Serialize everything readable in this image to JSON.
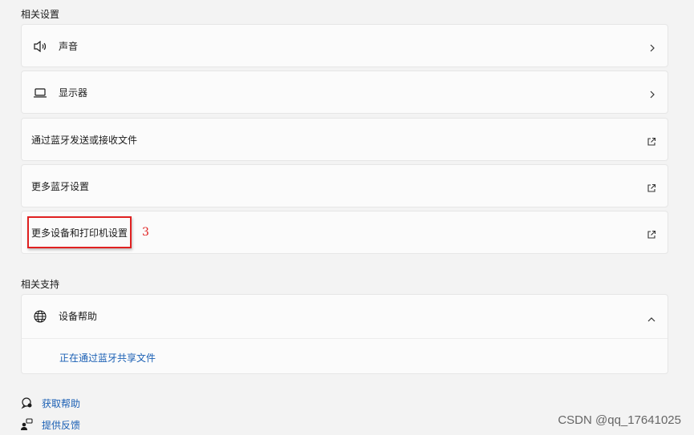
{
  "related_settings": {
    "title": "相关设置",
    "items": [
      {
        "label": "声音",
        "icon": "speaker-icon",
        "action": "chevron-right-icon"
      },
      {
        "label": "显示器",
        "icon": "laptop-icon",
        "action": "chevron-right-icon"
      },
      {
        "label": "通过蓝牙发送或接收文件",
        "icon": "",
        "action": "external-link-icon"
      },
      {
        "label": "更多蓝牙设置",
        "icon": "",
        "action": "external-link-icon"
      },
      {
        "label": "更多设备和打印机设置",
        "icon": "",
        "action": "external-link-icon"
      }
    ]
  },
  "annotation": {
    "number": "3",
    "color": "#e02020"
  },
  "related_support": {
    "title": "相关支持",
    "device_help": {
      "label": "设备帮助",
      "icon": "globe-icon",
      "expanded": true,
      "link": "正在通过蓝牙共享文件"
    }
  },
  "footer_links": [
    {
      "label": "获取帮助",
      "icon": "help-chat-icon"
    },
    {
      "label": "提供反馈",
      "icon": "feedback-icon"
    }
  ],
  "watermark": "CSDN @qq_17641025",
  "colors": {
    "accent_link": "#1a5fb4",
    "card_bg": "#fbfbfb",
    "page_bg": "#f3f3f3"
  }
}
